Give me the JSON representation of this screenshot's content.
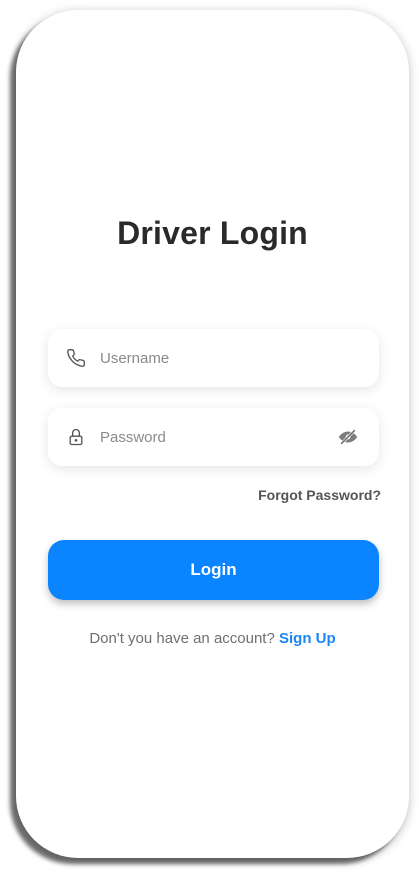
{
  "screen": {
    "title": "Driver Login"
  },
  "form": {
    "username": {
      "placeholder": "Username",
      "value": ""
    },
    "password": {
      "placeholder": "Password",
      "value": ""
    },
    "forgot_label": "Forgot Password?",
    "login_label": "Login"
  },
  "signup": {
    "prompt": "Don't you have an account?",
    "link_label": "Sign Up"
  },
  "colors": {
    "accent": "#0a84ff",
    "link": "#1a86f5",
    "title": "#2a2a2a"
  },
  "icons": {
    "username": "phone-icon",
    "password": "lock-icon",
    "toggle": "eye-off-icon"
  }
}
